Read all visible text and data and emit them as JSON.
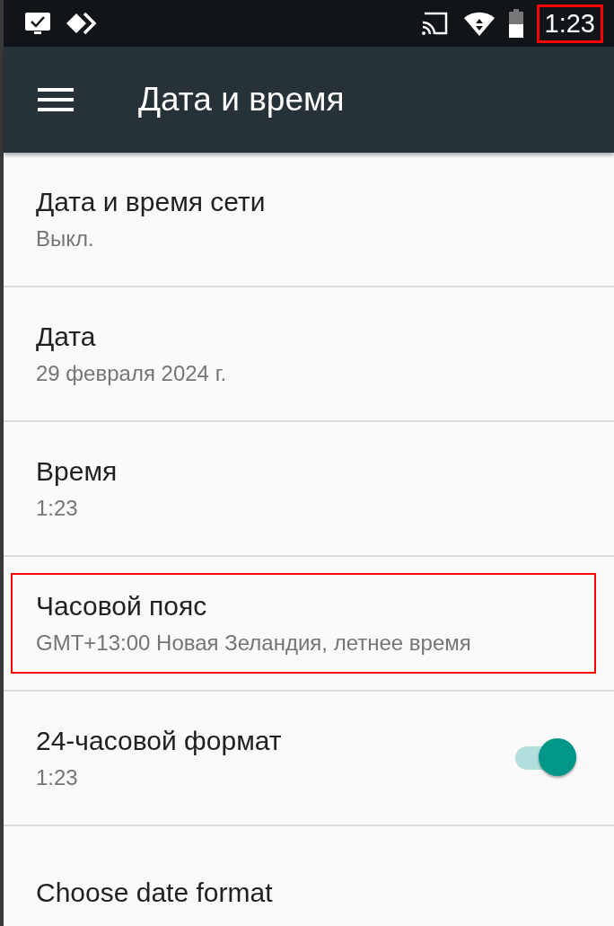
{
  "status_bar": {
    "time": "1:23",
    "time_highlighted": true
  },
  "toolbar": {
    "title": "Дата и время"
  },
  "settings": [
    {
      "kind": "text",
      "title": "Дата и время сети",
      "summary": "Выкл.",
      "highlighted": false
    },
    {
      "kind": "text",
      "title": "Дата",
      "summary": "29 февраля 2024 г.",
      "highlighted": false
    },
    {
      "kind": "text",
      "title": "Время",
      "summary": "1:23",
      "highlighted": false
    },
    {
      "kind": "text",
      "title": "Часовой пояс",
      "summary": "GMT+13:00 Новая Зеландия, летнее время",
      "highlighted": true
    },
    {
      "kind": "switch",
      "title": "24-часовой формат",
      "summary": "1:23",
      "on": true,
      "highlighted": false
    },
    {
      "kind": "text",
      "title": "Choose date format",
      "highlighted": false
    }
  ]
}
